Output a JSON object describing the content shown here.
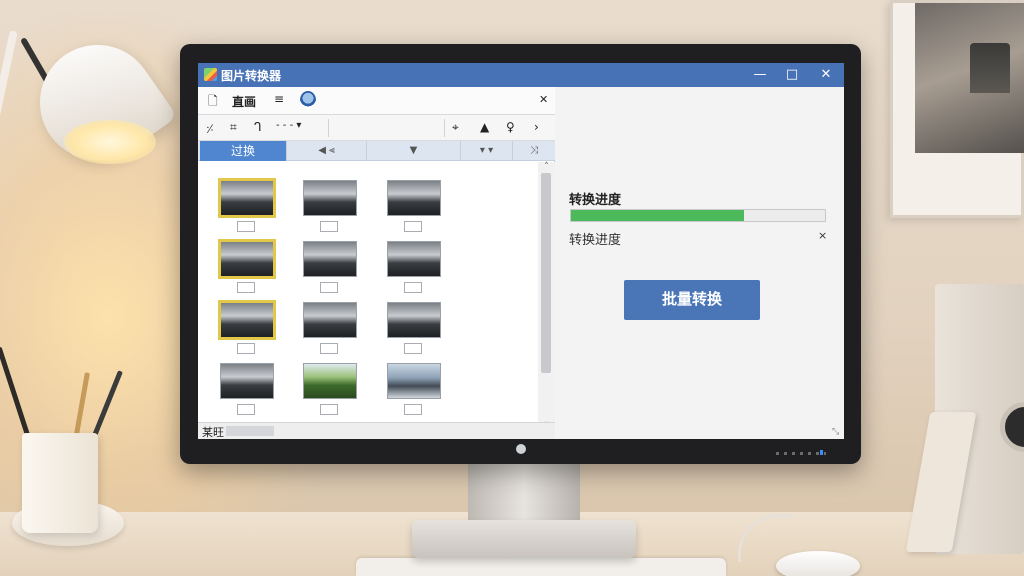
{
  "window": {
    "title": "图片转换器",
    "controls": {
      "minimize": "—",
      "maximize": "□",
      "close": "✕"
    }
  },
  "toolbar_primary": {
    "items": [
      "🗋",
      "直画",
      "≡"
    ],
    "close": "✕"
  },
  "toolbar_secondary": {
    "items": [
      "⸓",
      "⌗",
      "ᒉ",
      "- - - ▾"
    ],
    "right_icons": [
      "⌖",
      "▲",
      "♀",
      "›"
    ]
  },
  "tabs": {
    "active": "过换",
    "nav": "◀ ⫷",
    "dropdown": "▼",
    "sort": "▾ ▾",
    "shuffle": "⤨"
  },
  "thumbnails": [
    {
      "row": 0,
      "items": [
        {
          "selected": true
        },
        {
          "selected": false
        },
        {
          "selected": false
        }
      ]
    },
    {
      "row": 1,
      "items": [
        {
          "selected": true
        },
        {
          "selected": false
        },
        {
          "selected": false
        }
      ]
    },
    {
      "row": 2,
      "items": [
        {
          "selected": true
        },
        {
          "selected": false
        },
        {
          "selected": false
        }
      ]
    },
    {
      "row": 3,
      "items": [
        {
          "selected": false
        },
        {
          "selected": false,
          "style": "green"
        },
        {
          "selected": false,
          "style": "road"
        }
      ]
    }
  ],
  "statusbar": {
    "label": "某旺"
  },
  "progress": {
    "title": "转换进度",
    "percent": 68,
    "status_label": "转换进度",
    "close": "×",
    "color": "#4cb95a"
  },
  "actions": {
    "batch_convert": "批量转换"
  },
  "colors": {
    "titlebar": "#4872b6",
    "accent": "#4a76b8",
    "selection": "#e2c84a"
  }
}
